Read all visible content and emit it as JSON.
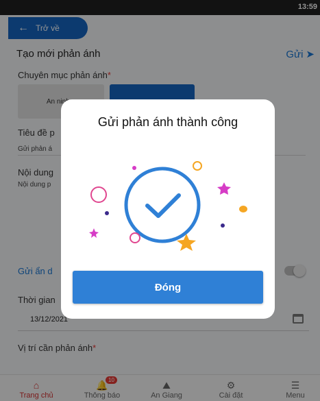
{
  "status": {
    "time": "13:59"
  },
  "header": {
    "back_label": "Trở về",
    "title": "Tạo mới phản ánh",
    "send_label": "Gửi"
  },
  "form": {
    "category_label": "Chuyên mục phản ánh",
    "category_option_1": "An ninh...",
    "title_label": "Tiêu đề p",
    "title_value": "Gửi phản á",
    "content_label": "Nội dung",
    "content_value": "Nội dung p",
    "anonymous_label": "Gửi ẩn d",
    "time_label": "Thời gian",
    "date_value": "13/12/2021",
    "location_label": "Vị trí cần phản ánh"
  },
  "modal": {
    "title": "Gửi phản ánh thành công",
    "close_label": "Đóng"
  },
  "bottom_nav": {
    "items": [
      {
        "label": "Trang chủ"
      },
      {
        "label": "Thông báo",
        "badge": "10"
      },
      {
        "label": "An Giang"
      },
      {
        "label": "Cài đặt"
      },
      {
        "label": "Menu"
      }
    ]
  },
  "colors": {
    "primary": "#1565c0",
    "button": "#2f80d6",
    "star_pink": "#d63cc6",
    "star_orange": "#f5a623"
  }
}
